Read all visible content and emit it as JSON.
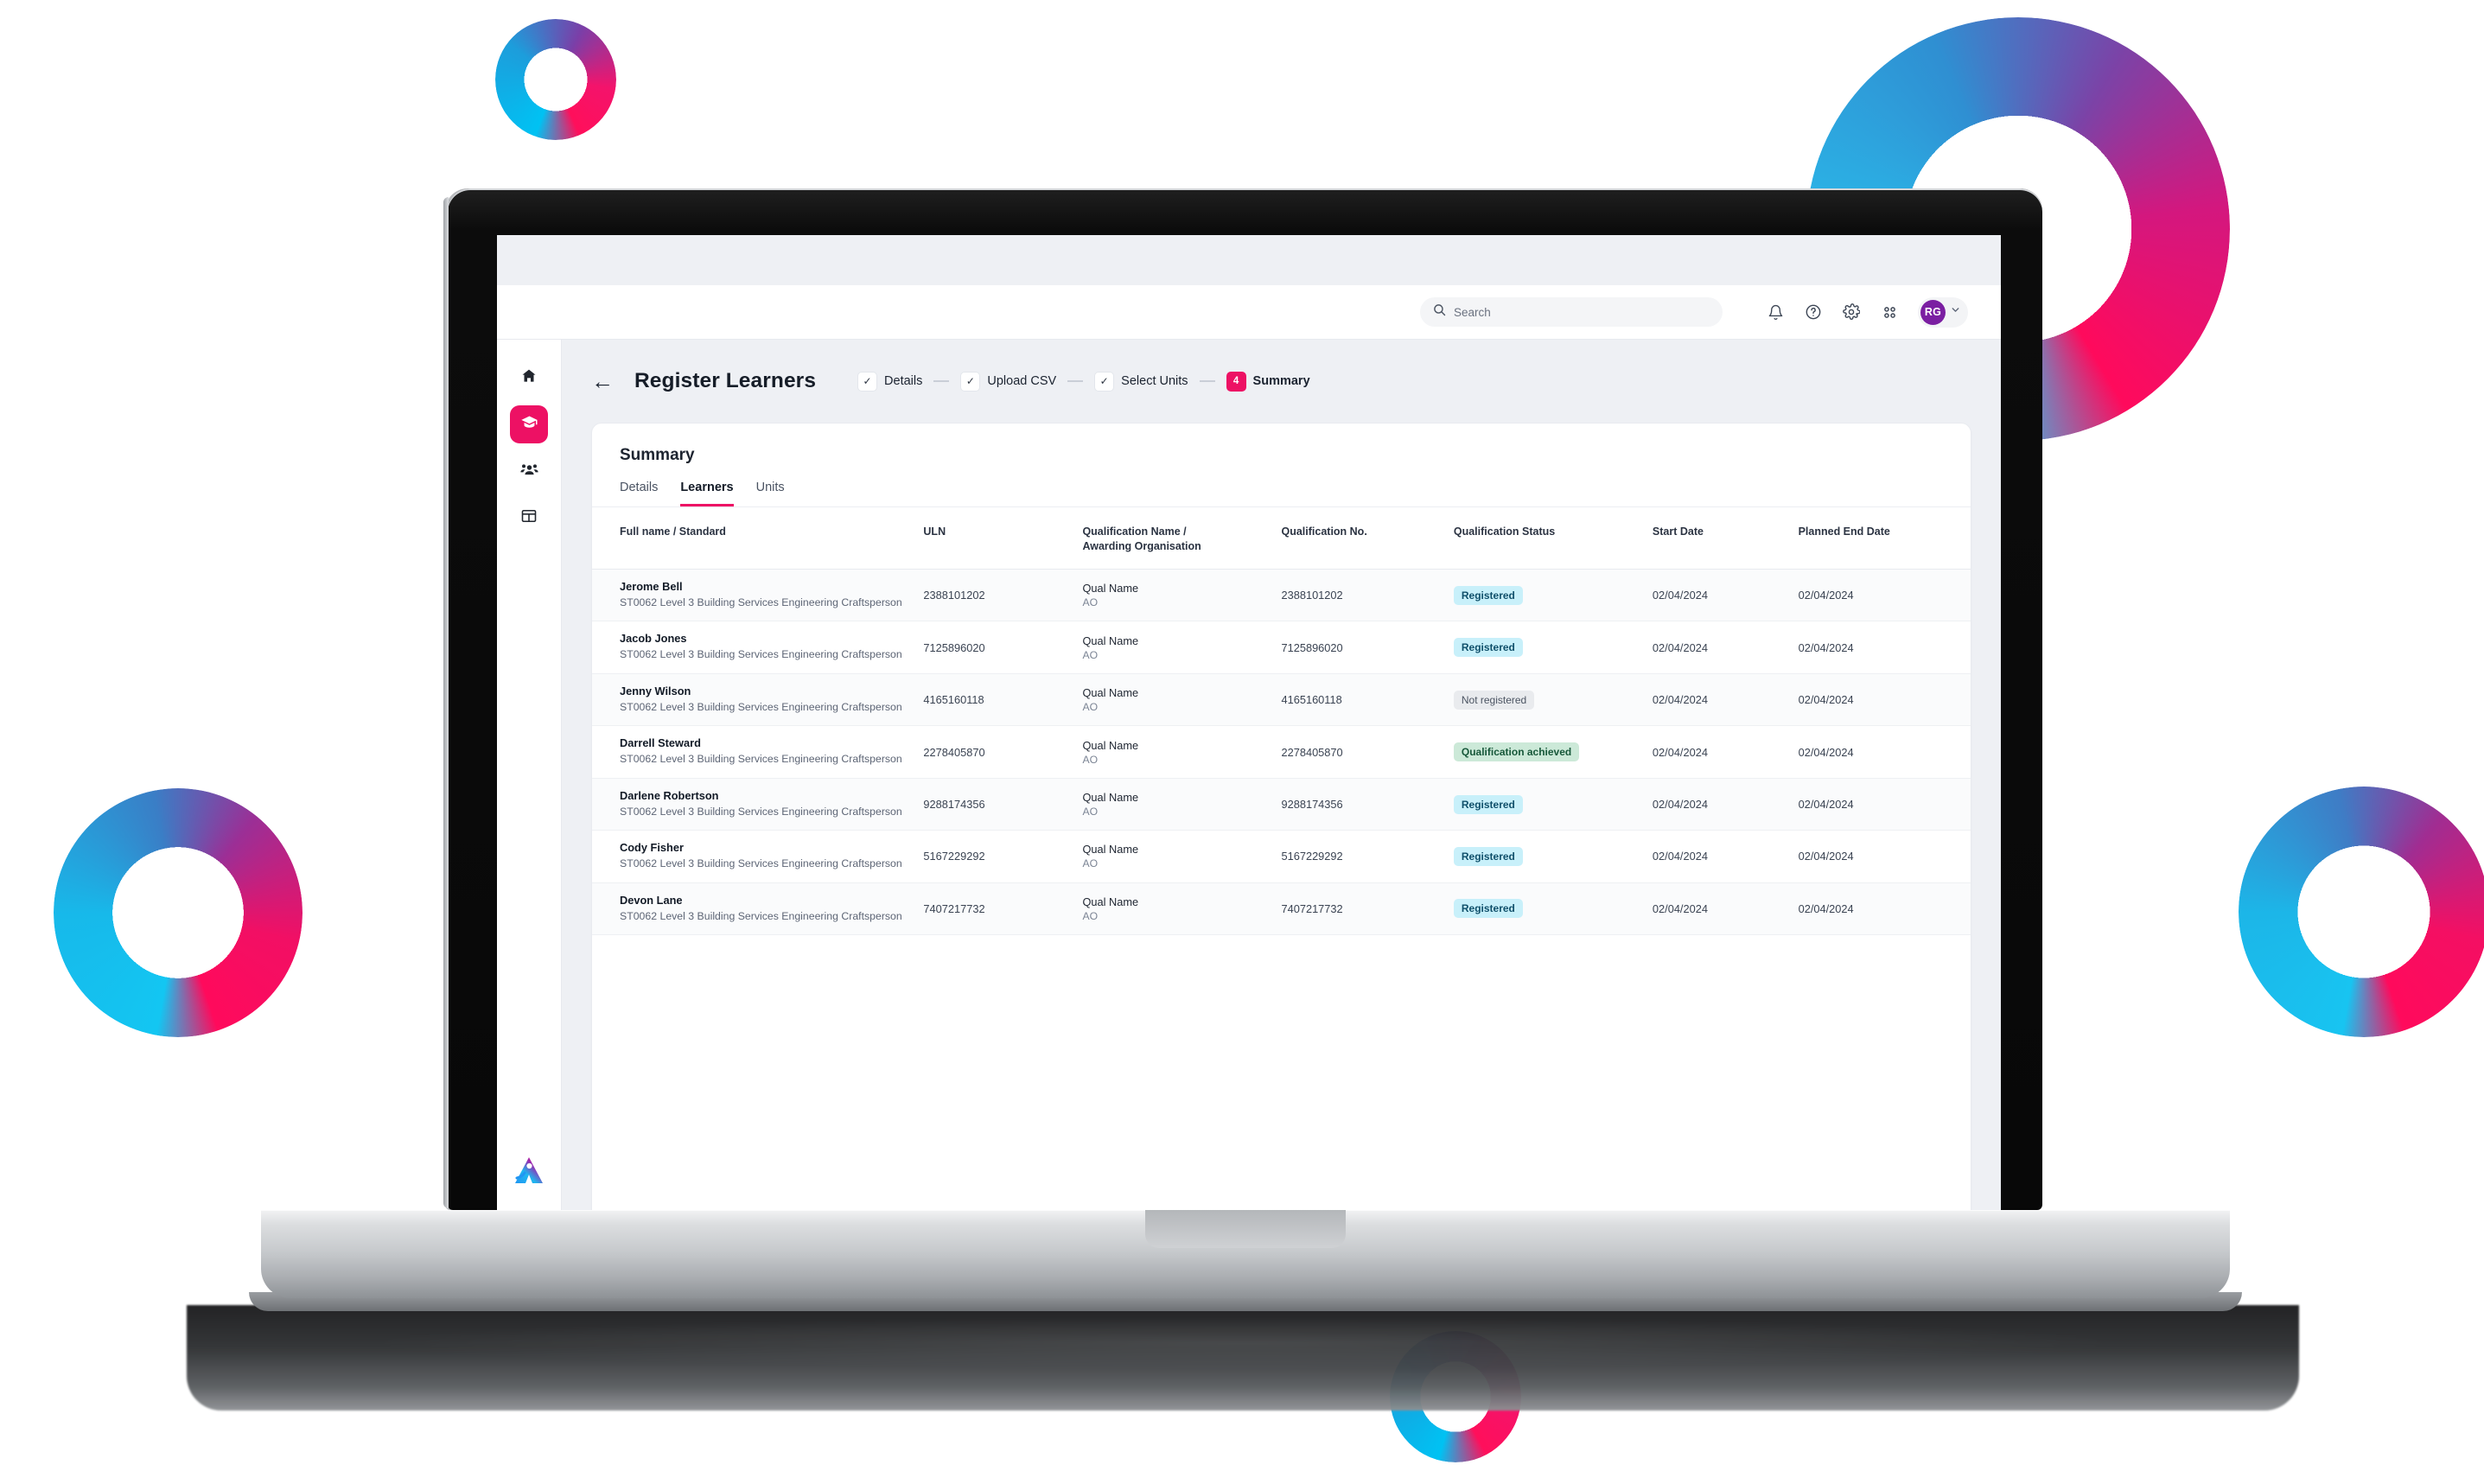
{
  "decor": {
    "rings": [
      "ring-top-left",
      "ring-top-right",
      "ring-left",
      "ring-right",
      "ring-bottom"
    ],
    "accent_cyan": "#00c2f3",
    "accent_pink": "#ff0a5c",
    "accent_purple": "#7b1fa2"
  },
  "appbar": {
    "search": {
      "placeholder": "Search",
      "value": ""
    },
    "icons": [
      "bell-icon",
      "help-icon",
      "gear-icon",
      "apps-grid-icon"
    ],
    "avatar_initials": "RG"
  },
  "sidebar": {
    "items": [
      {
        "name": "home",
        "icon": "home-icon",
        "active": false
      },
      {
        "name": "learners",
        "icon": "graduation-cap-icon",
        "active": true
      },
      {
        "name": "people",
        "icon": "people-icon",
        "active": false
      },
      {
        "name": "table",
        "icon": "table-grid-icon",
        "active": false
      }
    ],
    "logo": "aptem-triangle-logo"
  },
  "page": {
    "back_label": "←",
    "title": "Register Learners",
    "steps": [
      {
        "label": "Details",
        "mark": "✓",
        "state": "complete"
      },
      {
        "label": "Upload CSV",
        "mark": "✓",
        "state": "complete"
      },
      {
        "label": "Select Units",
        "mark": "✓",
        "state": "complete"
      },
      {
        "label": "Summary",
        "mark": "4",
        "state": "current"
      }
    ]
  },
  "card": {
    "title": "Summary",
    "tabs": [
      {
        "label": "Details",
        "active": false
      },
      {
        "label": "Learners",
        "active": true
      },
      {
        "label": "Units",
        "active": false
      }
    ]
  },
  "table": {
    "columns": [
      "Full name / Standard",
      "ULN",
      "Qualification Name / Awarding Organisation",
      "Qualification No.",
      "Qualification Status",
      "Start Date",
      "Planned End  Date"
    ],
    "column_lines": {
      "qual_line1": "Qualification Name /",
      "qual_line2": "Awarding Organisation"
    },
    "rows": [
      {
        "name": "Jerome Bell",
        "standard": "ST0062 Level 3 Building Services Engineering Craftsperson",
        "uln": "2388101202",
        "qual_name": "Qual Name",
        "qual_ao": "AO",
        "qual_no": "2388101202",
        "status": "Registered",
        "status_kind": "registered",
        "start_date": "02/04/2024",
        "end_date": "02/04/2024"
      },
      {
        "name": "Jacob Jones",
        "standard": "ST0062 Level 3 Building Services Engineering Craftsperson",
        "uln": "7125896020",
        "qual_name": "Qual Name",
        "qual_ao": "AO",
        "qual_no": "7125896020",
        "status": "Registered",
        "status_kind": "registered",
        "start_date": "02/04/2024",
        "end_date": "02/04/2024"
      },
      {
        "name": "Jenny Wilson",
        "standard": "ST0062 Level 3 Building Services Engineering Craftsperson",
        "uln": "4165160118",
        "qual_name": "Qual Name",
        "qual_ao": "AO",
        "qual_no": "4165160118",
        "status": "Not registered",
        "status_kind": "notreg",
        "start_date": "02/04/2024",
        "end_date": "02/04/2024"
      },
      {
        "name": "Darrell Steward",
        "standard": "ST0062 Level 3 Building Services Engineering Craftsperson",
        "uln": "2278405870",
        "qual_name": "Qual Name",
        "qual_ao": "AO",
        "qual_no": "2278405870",
        "status": "Qualification achieved",
        "status_kind": "achieved",
        "start_date": "02/04/2024",
        "end_date": "02/04/2024"
      },
      {
        "name": "Darlene Robertson",
        "standard": "ST0062 Level 3 Building Services Engineering Craftsperson",
        "uln": "9288174356",
        "qual_name": "Qual Name",
        "qual_ao": "AO",
        "qual_no": "9288174356",
        "status": "Registered",
        "status_kind": "registered",
        "start_date": "02/04/2024",
        "end_date": "02/04/2024"
      },
      {
        "name": "Cody Fisher",
        "standard": "ST0062 Level 3 Building Services Engineering Craftsperson",
        "uln": "5167229292",
        "qual_name": "Qual Name",
        "qual_ao": "AO",
        "qual_no": "5167229292",
        "status": "Registered",
        "status_kind": "registered",
        "start_date": "02/04/2024",
        "end_date": "02/04/2024"
      },
      {
        "name": "Devon Lane",
        "standard": "ST0062 Level 3 Building Services Engineering Craftsperson",
        "uln": "7407217732",
        "qual_name": "Qual Name",
        "qual_ao": "AO",
        "qual_no": "7407217732",
        "status": "Registered",
        "status_kind": "registered",
        "start_date": "02/04/2024",
        "end_date": "02/04/2024"
      }
    ]
  }
}
